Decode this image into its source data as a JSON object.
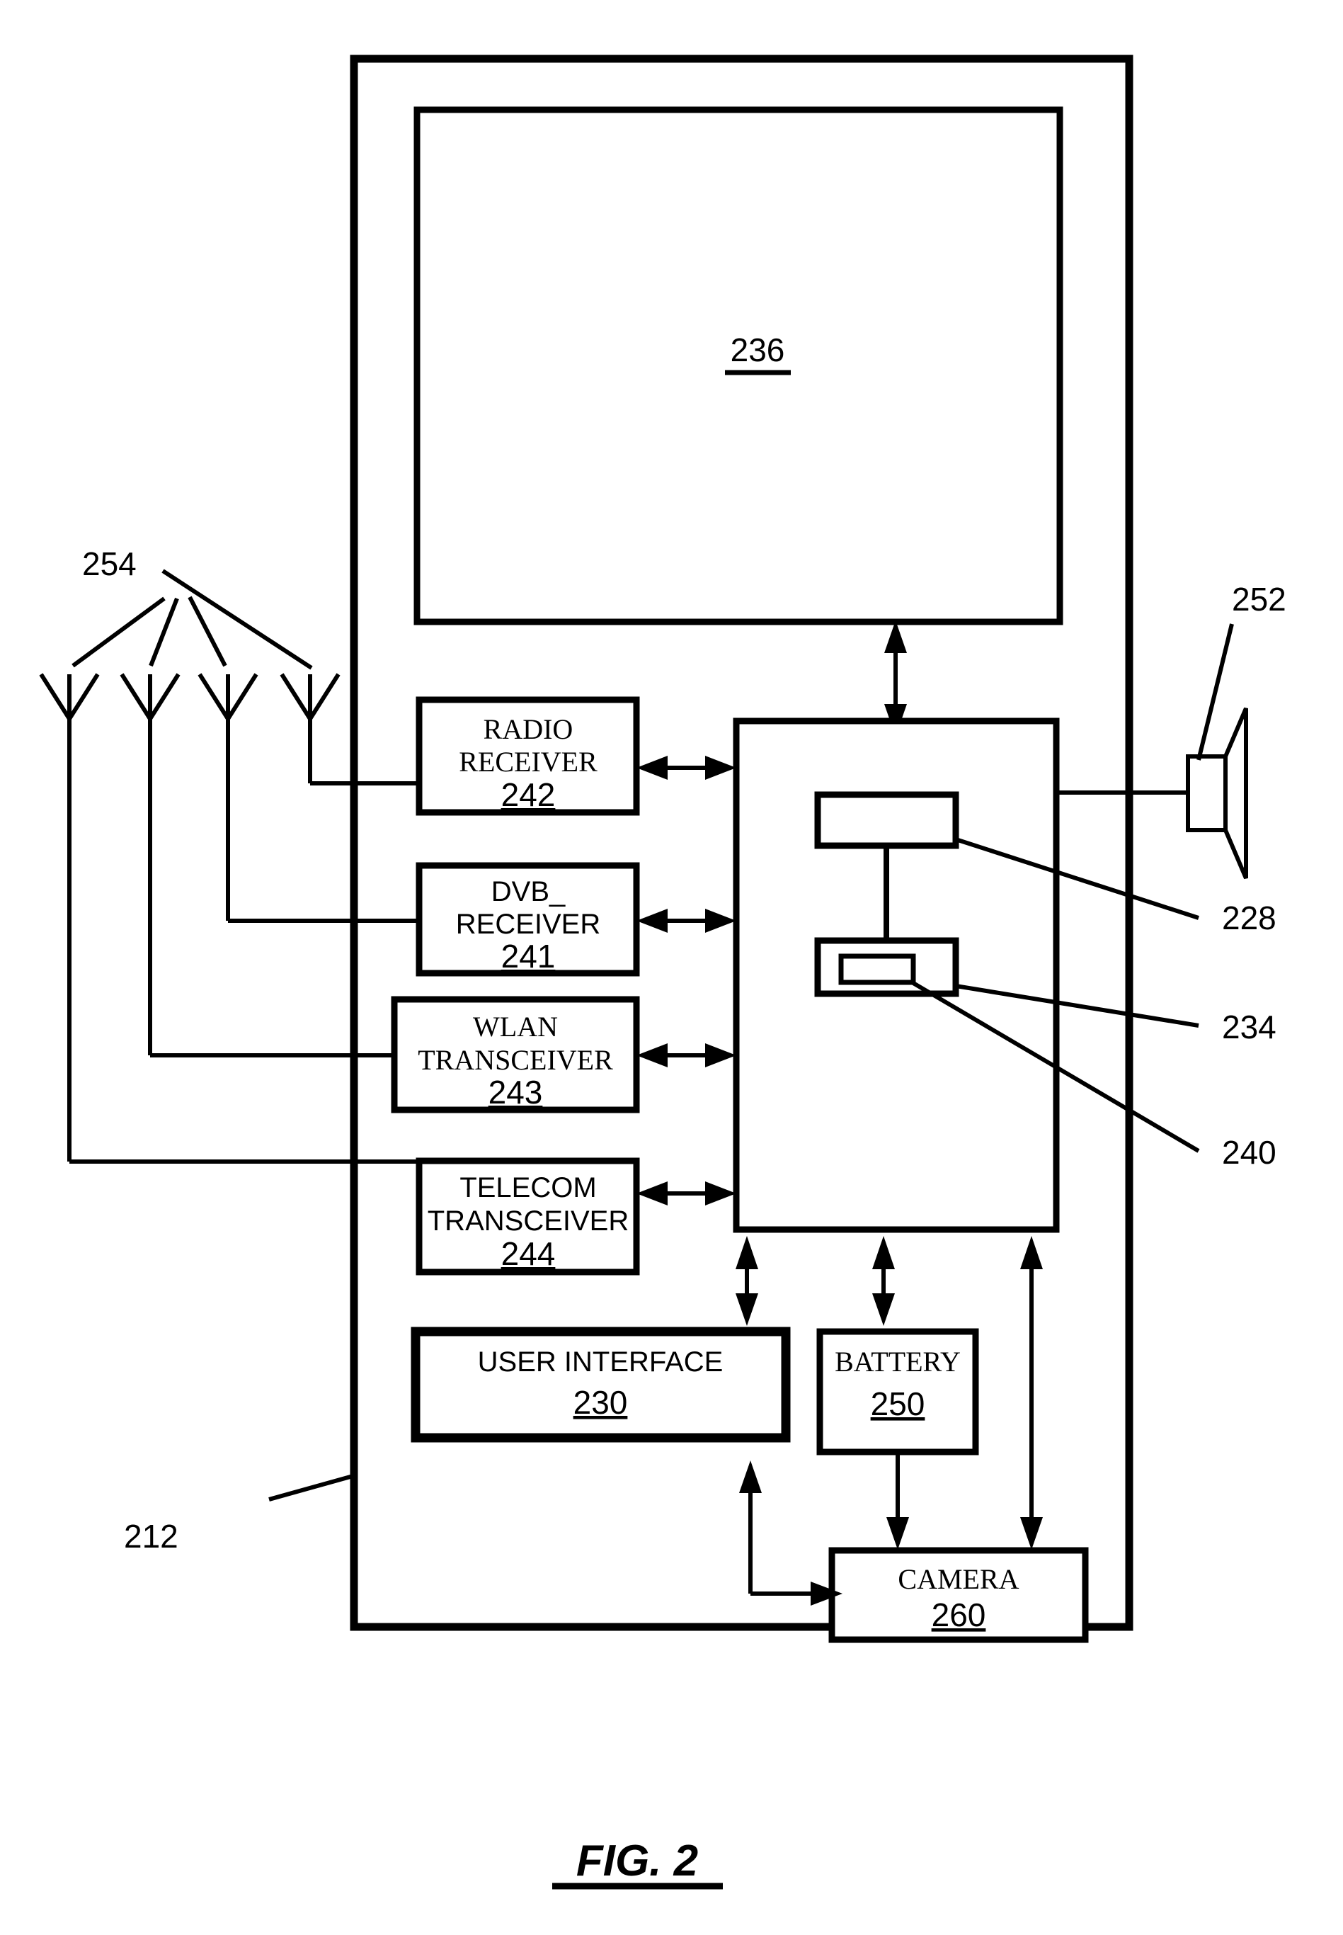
{
  "figure": {
    "caption": "FIG. 2",
    "device_ref": "212"
  },
  "display": {
    "ref": "236"
  },
  "antennas": {
    "ref": "254",
    "count": 4
  },
  "speaker": {
    "ref": "252"
  },
  "internal_refs": {
    "memory": "228",
    "processor": "234",
    "core": "240"
  },
  "blocks": [
    {
      "id": "radio-receiver",
      "line1": "RADIO",
      "line2": "RECEIVER",
      "ref": "242",
      "font": "serif"
    },
    {
      "id": "dvb-receiver",
      "line1": "DVB_",
      "line2": "RECEIVER",
      "ref": "241",
      "font": "sans"
    },
    {
      "id": "wlan-transceiver",
      "line1": "WLAN",
      "line2": "TRANSCEIVER",
      "ref": "243",
      "font": "serif"
    },
    {
      "id": "telecom-transceiver",
      "line1": "TELECOM",
      "line2": "TRANSCEIVER",
      "ref": "244",
      "font": "sans"
    },
    {
      "id": "user-interface",
      "line1": "USER INTERFACE",
      "line2": "",
      "ref": "230",
      "font": "sans"
    },
    {
      "id": "battery",
      "line1": "BATTERY",
      "line2": "",
      "ref": "250",
      "font": "serif"
    },
    {
      "id": "camera",
      "line1": "CAMERA",
      "line2": "",
      "ref": "260",
      "font": "serif"
    }
  ],
  "colors": {
    "stroke": "#000000",
    "background": "#ffffff"
  }
}
